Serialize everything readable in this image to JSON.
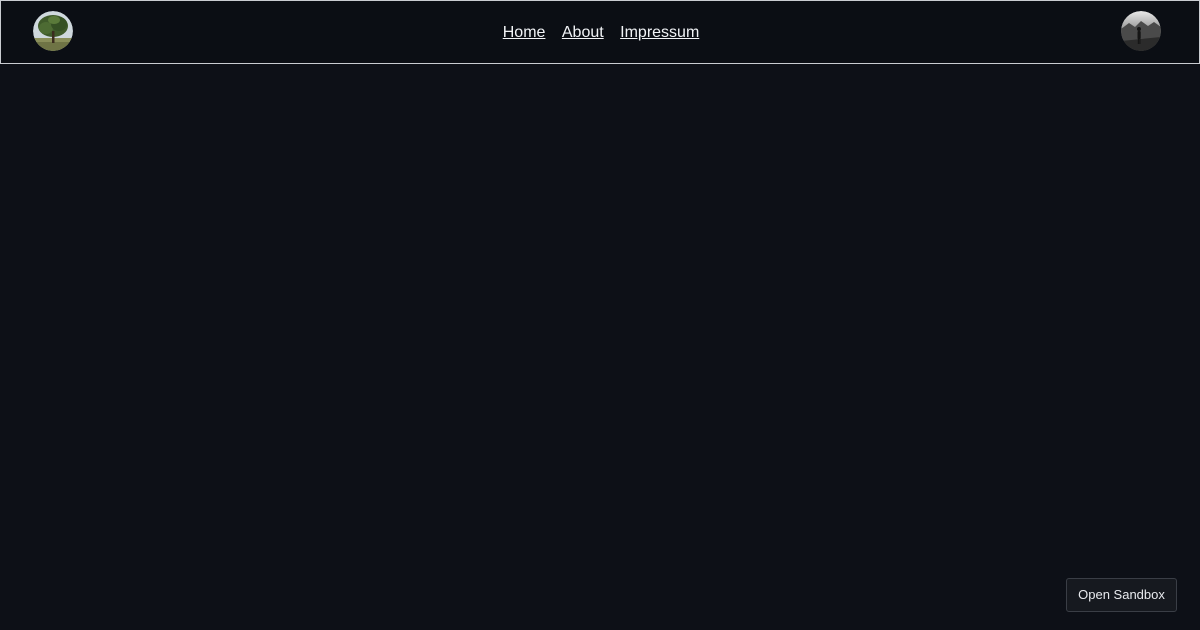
{
  "navbar": {
    "left_avatar_icon": "tree-photo-avatar",
    "right_avatar_icon": "person-silhouette-avatar",
    "links": [
      {
        "label": "Home"
      },
      {
        "label": "About"
      },
      {
        "label": "Impressum"
      }
    ]
  },
  "sandbox": {
    "label": "Open Sandbox"
  },
  "colors": {
    "background": "#0d1017",
    "navbar_border": "#c9ccd1",
    "link_text": "#f2f4f7",
    "button_background": "#16191f"
  }
}
